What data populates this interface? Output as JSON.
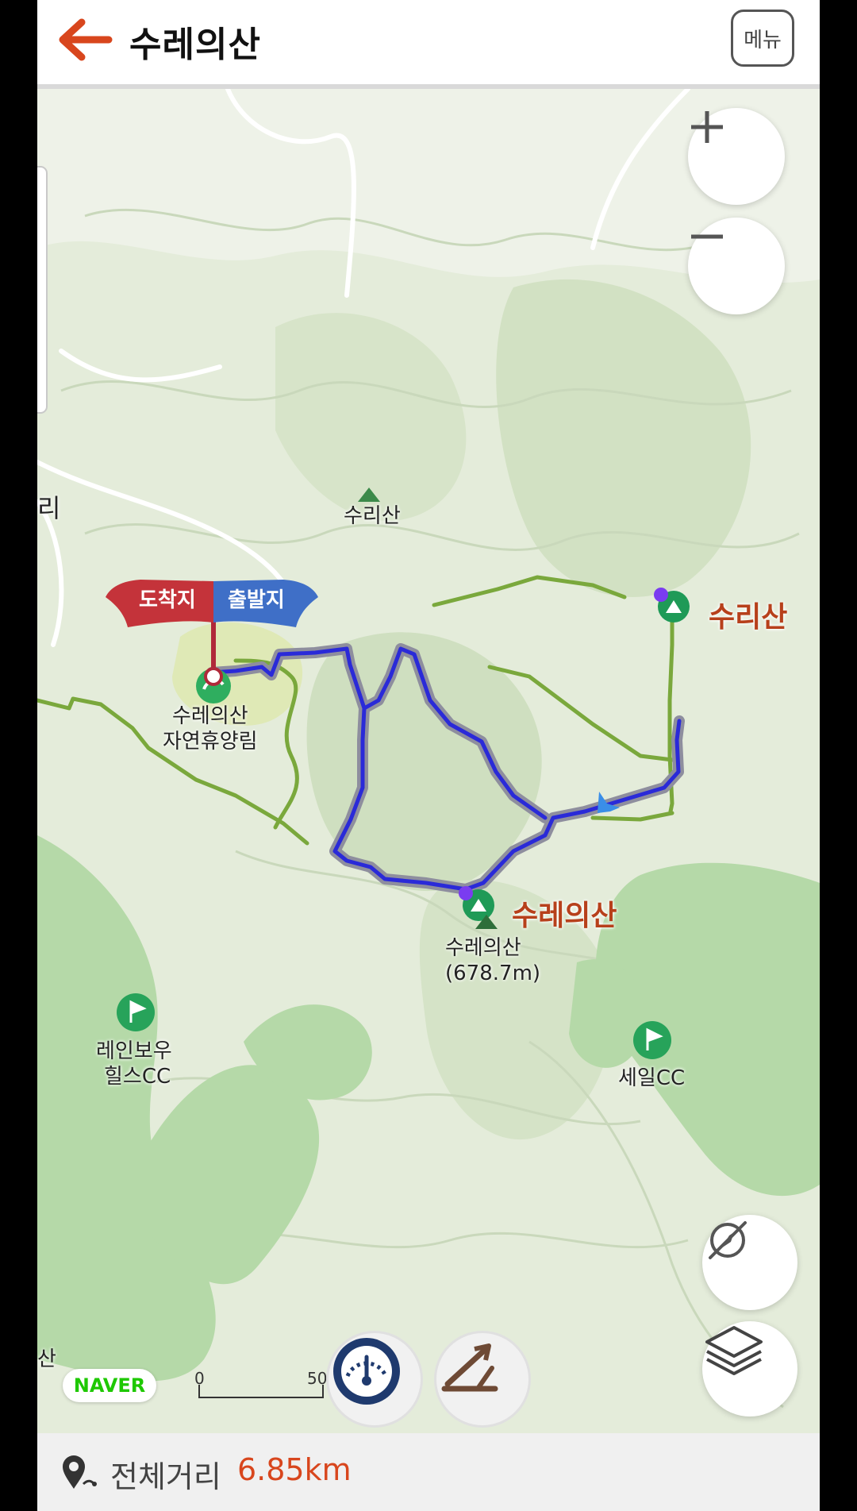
{
  "header": {
    "title": "수레의산",
    "menu_label": "메뉴"
  },
  "flags": {
    "arrival": "도착지",
    "departure": "출발지"
  },
  "map_labels": {
    "suri_mountain_small": "수리산",
    "recreation_forest": [
      "수레의산",
      "자연휴양림"
    ],
    "summit": [
      "수레의산",
      "(678.7m)"
    ],
    "rainbow_cc": [
      "레인보우",
      "힐스CC"
    ],
    "seil_cc": "세일CC",
    "edge_left_top": "리",
    "edge_left_bottom": "산"
  },
  "peaks": {
    "suri": "수리산",
    "surae": "수레의산"
  },
  "naver_logo": "NAVER",
  "scale": {
    "start": "0",
    "end": "50"
  },
  "footer": {
    "label": "전체거리",
    "value": "6.85km"
  },
  "colors": {
    "route": "#2a2ad8",
    "trail": "#7aa83c",
    "peak_text": "#b7401b",
    "distance": "#d8461d"
  },
  "icons": [
    "back-arrow-icon",
    "zoom-in-icon",
    "zoom-out-icon",
    "compass-off-icon",
    "layers-icon",
    "speedometer-icon",
    "slope-icon",
    "location-pin-icon"
  ]
}
